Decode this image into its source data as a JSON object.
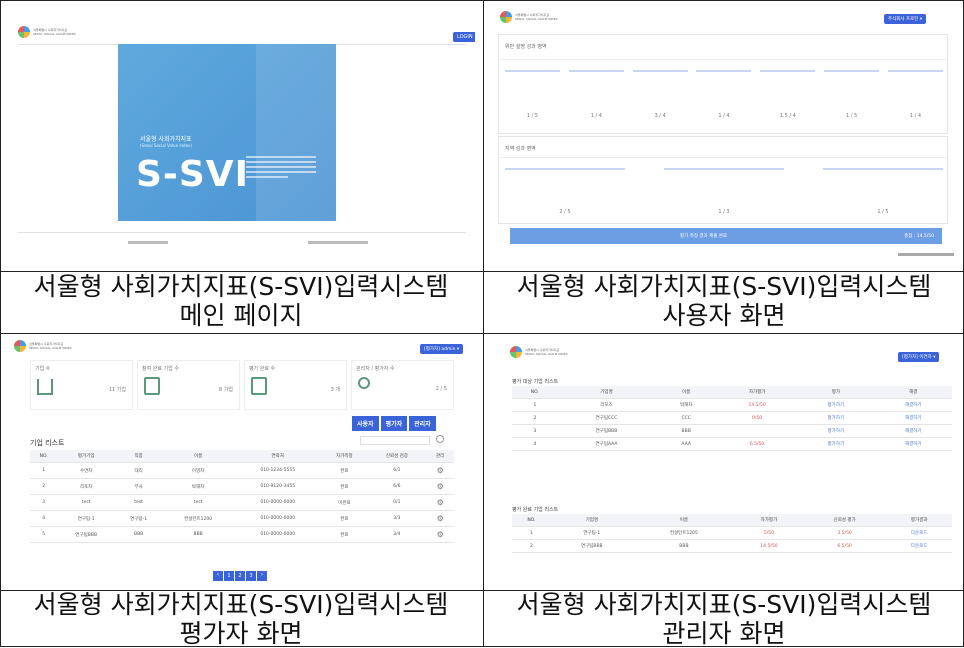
{
  "captions": {
    "main": [
      "서울형 사회가치지표(S-SVI)입력시스템",
      "메인 페이지"
    ],
    "user": [
      "서울형 사회가치지표(S-SVI)입력시스템",
      "사용자 화면"
    ],
    "evaluator": [
      "서울형 사회가치지표(S-SVI)입력시스템",
      "평가자 화면"
    ],
    "admin": [
      "서울형 사회가치지표(S-SVI)입력시스템",
      "관리자 화면"
    ]
  },
  "main_page": {
    "login": "LOGIN",
    "hero_title": "서울형 사회가치지표",
    "hero_sub": "(Seoul Social Value Index)",
    "hero_big": "S-SVI"
  },
  "user_page": {
    "badge": "주식회사 프로틴 ▾",
    "section1": "위반 설명 성과 영역",
    "section1_scores": [
      "1 / 5",
      "1 / 4",
      "3 / 4",
      "1 / 4",
      "1.5 / 4",
      "1 / 5",
      "1 / 4"
    ],
    "section2": "지역 성과 영역",
    "section2_scores": [
      "2 / 5",
      "1 / 3",
      "1 / 5"
    ],
    "bar_left": "평가 측정 결과 제출 완료",
    "bar_right": "총점 : 14.5/50"
  },
  "eval_page": {
    "badge": "[평가자] admin ▾",
    "stats": [
      {
        "label": "기업 수",
        "value": "11 기업"
      },
      {
        "label": "참여 완료 기업 수",
        "value": "8 기업"
      },
      {
        "label": "평가 완료 수",
        "value": "3 개"
      },
      {
        "label": "관리자 / 평가자 수",
        "value": "2 / 5"
      }
    ],
    "role_tabs": [
      "사용자",
      "평가자",
      "관리자"
    ],
    "list_title": "기업 리스트",
    "headers": [
      "NO.",
      "평가기업",
      "직함",
      "이름",
      "연락처",
      "자가측정",
      "신뢰성 검증",
      "관리"
    ],
    "rows": [
      [
        "1",
        "수면차",
        "대리",
        "이영차",
        "010-1234-5555",
        "완료",
        "6/1",
        ""
      ],
      [
        "2",
        "리포차",
        "부사",
        "박해차",
        "010-9120-3455",
        "완료",
        "6/6",
        ""
      ],
      [
        "3",
        "test",
        "test",
        "test",
        "010-0000-0000",
        "미완료",
        "0/1",
        ""
      ],
      [
        "4",
        "연구팀-1",
        "연구팀-1",
        "컨설턴트1200",
        "010-0000-0000",
        "완료",
        "3/3",
        ""
      ],
      [
        "5",
        "연구팀BBB",
        "BBB",
        "BBB",
        "010-0000-0000",
        "완료",
        "3/4",
        ""
      ]
    ],
    "pages": [
      "1",
      "2",
      "3"
    ]
  },
  "admin_page": {
    "badge": "[평가자] 이연차 ▾",
    "list1_title": "평가 대상 기업 리스트",
    "list1_headers": [
      "NO.",
      "기업명",
      "이름",
      "자가평가",
      "평가",
      "해결"
    ],
    "list1_rows": [
      [
        "1",
        "리포츠",
        "박해차",
        "14.5/50",
        "평가하기",
        "해결하기"
      ],
      [
        "2",
        "연구팀CCC",
        "CCC",
        "0/50",
        "평가하기",
        "해결하기"
      ],
      [
        "3",
        "연구팀BBB",
        "BBB",
        "",
        "평가하기",
        "해결하기"
      ],
      [
        "4",
        "연구팀AAA",
        "AAA",
        "6.5/50",
        "평가하기",
        "해결하기"
      ]
    ],
    "list2_title": "평가 완료 기업 리스트",
    "list2_headers": [
      "NO.",
      "기업명",
      "이름",
      "자가평가",
      "신뢰성 평가",
      "평가결과"
    ],
    "list2_rows": [
      [
        "1",
        "연구팀-1",
        "컨설턴트1205",
        "5/50",
        "3.5/50",
        "다운로드"
      ],
      [
        "2",
        "연구팀BBB",
        "BBB",
        "14.5/50",
        "6.5/50",
        "다운로드"
      ]
    ]
  }
}
